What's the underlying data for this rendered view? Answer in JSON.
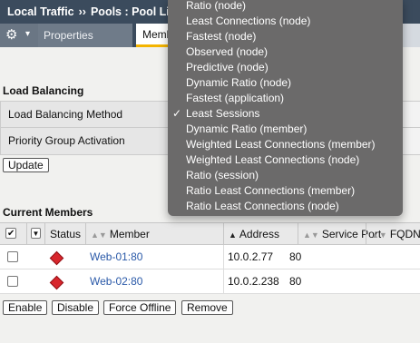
{
  "header": {
    "crumbs": [
      "Local Traffic",
      "Pools : Pool Li"
    ],
    "separator": "››"
  },
  "tabs": {
    "gear_icon": "gear-icon",
    "properties": "Properties",
    "members": "Members"
  },
  "load_balancing": {
    "heading": "Load Balancing",
    "rows": [
      {
        "label": "Load Balancing Method"
      },
      {
        "label": "Priority Group Activation"
      }
    ],
    "update_button": "Update"
  },
  "current_members": {
    "heading": "Current Members",
    "columns": [
      "",
      "Status",
      "Member",
      "Address",
      "Service Port",
      "FQDN"
    ],
    "rows": [
      {
        "status": "down",
        "member": "Web-01:80",
        "address": "10.0.2.77",
        "port": "80"
      },
      {
        "status": "down",
        "member": "Web-02:80",
        "address": "10.0.2.238",
        "port": "80"
      }
    ],
    "buttons": [
      "Enable",
      "Disable",
      "Force Offline",
      "Remove"
    ]
  },
  "lb_method_menu": {
    "selected": "Least Sessions",
    "options": [
      "Ratio (node)",
      "Least Connections (node)",
      "Fastest (node)",
      "Observed (node)",
      "Predictive (node)",
      "Dynamic Ratio (node)",
      "Fastest (application)",
      "Least Sessions",
      "Dynamic Ratio (member)",
      "Weighted Least Connections (member)",
      "Weighted Least Connections (node)",
      "Ratio (session)",
      "Ratio Least Connections (member)",
      "Ratio Least Connections (node)"
    ]
  },
  "colors": {
    "header": "#3b4b5d",
    "accent_tab": "#f4b400",
    "status_down": "#d8262c",
    "link": "#2a59a8",
    "menu_bg": "#6b6a6a"
  }
}
